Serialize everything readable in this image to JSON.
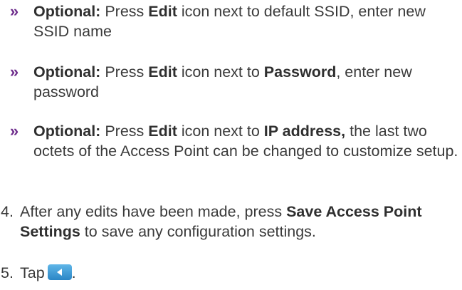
{
  "bullet_marker": "»",
  "items": [
    {
      "label": "Optional:",
      "t1": " Press ",
      "b1": "Edit",
      "t2": " icon next to default SSID, enter new SSID name"
    },
    {
      "label": "Optional:",
      "t1": " Press ",
      "b1": "Edit",
      "t2": " icon next to ",
      "b2": "Password",
      "t3": ", enter new password"
    },
    {
      "label": "Optional:",
      "t1": " Press ",
      "b1": "Edit",
      "t2": " icon next to ",
      "b2": "IP address,",
      "t3": " the last two octets of the Access Point can be changed to customize setup."
    }
  ],
  "steps": [
    {
      "number": "4.",
      "t1": "After any edits have been made, press ",
      "b1": "Save Access Point Settings",
      "t2": " to save any configuration settings."
    },
    {
      "number": "5.",
      "t1": "Tap",
      "icon": "back-arrow-icon",
      "t2": "."
    }
  ],
  "colors": {
    "marker": "#6e2d8c",
    "text": "#3a3a3a",
    "icon_blue": "#2b86c6"
  }
}
